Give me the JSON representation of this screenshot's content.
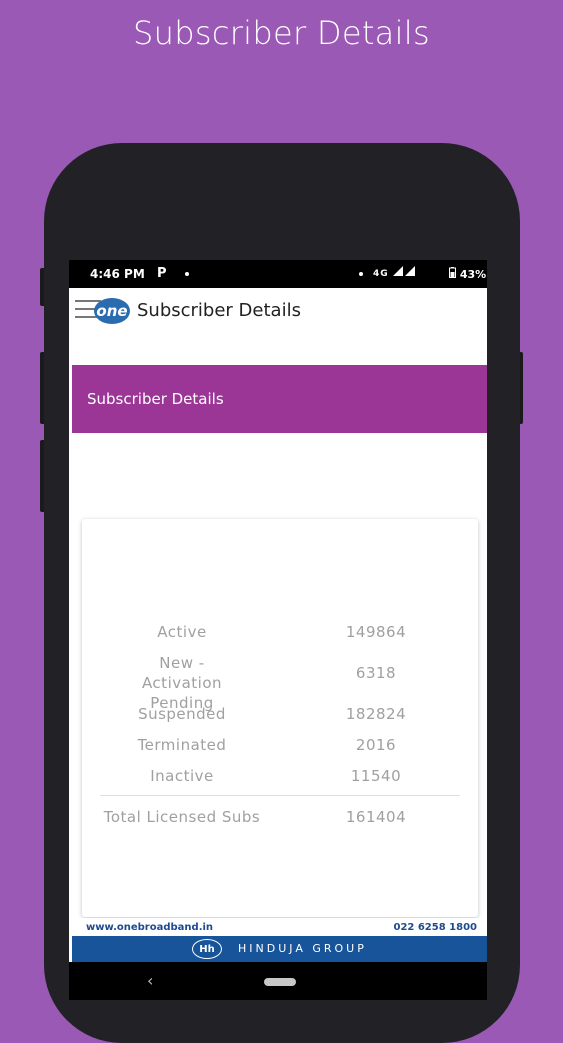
{
  "page_headline": "Subscriber Details",
  "status_bar": {
    "time": "4:46 PM",
    "network": "4G",
    "battery": "43%"
  },
  "app_bar": {
    "logo_text": "one",
    "title": "Subscriber Details"
  },
  "banner": {
    "title": "Subscriber Details"
  },
  "subscriber_stats": {
    "rows": [
      {
        "label": "Active",
        "value": "149864"
      },
      {
        "label": "New - Activation Pending",
        "value": "6318"
      },
      {
        "label": "Suspended",
        "value": "182824"
      },
      {
        "label": "Terminated",
        "value": "2016"
      },
      {
        "label": "Inactive",
        "value": "11540"
      }
    ],
    "total": {
      "label": "Total Licensed Subs",
      "value": "161404"
    }
  },
  "footer": {
    "website": "www.onebroadband.in",
    "phone": "022 6258 1800",
    "group_emblem": "Hh",
    "group": "HINDUJA GROUP"
  },
  "colors": {
    "background": "#9b59b6",
    "banner": "#9b3696",
    "footer_bar": "#17549a"
  }
}
